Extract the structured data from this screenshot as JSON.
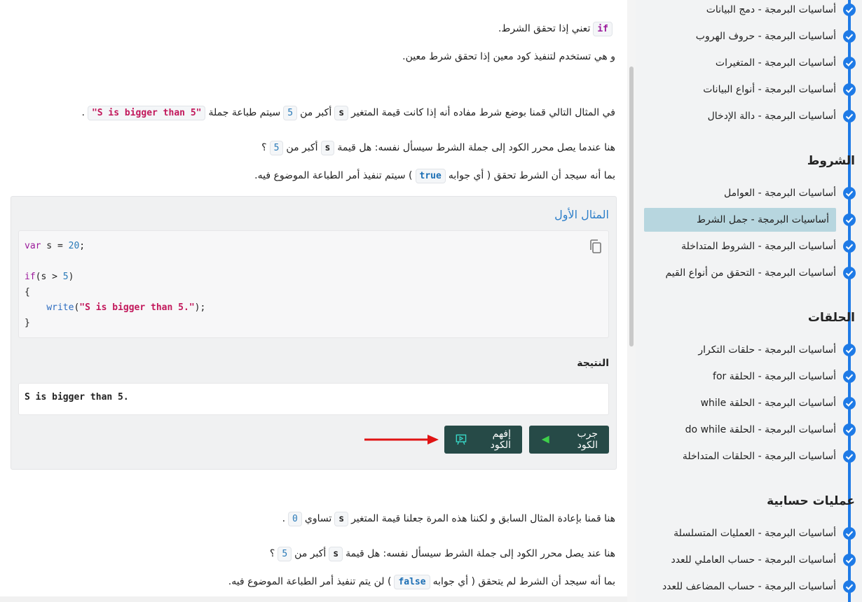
{
  "main": {
    "p1": {
      "code": "if",
      "text": "تعني إذا تحقق الشرط."
    },
    "p2": {
      "text": "و هي تستخدم لتنفيذ كود معين إذا تحقق شرط معين."
    },
    "p3": {
      "a": "في المثال التالي قمنا بوضع شرط مفاده أنه إذا كانت قيمة المتغير",
      "var": "s",
      "b": "أكبر من",
      "num": "5",
      "c": "سيتم طباعة جملة",
      "str": "\"S is bigger than 5\"",
      "d": "."
    },
    "p4": {
      "a": "هنا عندما يصل محرر الكود إلى جملة الشرط سيسأل نفسه: هل قيمة",
      "var": "s",
      "b": "أكبر من",
      "num": "5",
      "c": "؟"
    },
    "p5": {
      "a": "بما أنه سيجد أن الشرط تحقق ( أي جوابه",
      "bool": "true",
      "b": ") سيتم تنفيذ أمر الطباعة الموضوع فيه."
    },
    "example": {
      "title": "المثال الأول",
      "code": {
        "line1": {
          "kw": "var",
          "rest": " s = ",
          "num": "20",
          "end": ";"
        },
        "line3": {
          "kw": "if",
          "a": "(s > ",
          "num": "5",
          "b": ")"
        },
        "line4": "{",
        "line5": {
          "indent": "    ",
          "fn": "write",
          "a": "(",
          "str": "\"S is bigger than 5.\"",
          "b": ");"
        },
        "line6": "}"
      },
      "result_label": "النتيجة",
      "result": "S is bigger than 5.",
      "try_button": "جرب الكود",
      "explain_button": "إفهم الكود"
    },
    "p6": {
      "a": "هنا قمنا بإعادة المثال السابق و لكننا هذه المرة جعلنا قيمة المتغير",
      "var": "s",
      "b": "تساوي",
      "num": "0",
      "c": "."
    },
    "p7": {
      "a": "هنا عند يصل محرر الكود إلى جملة الشرط سيسأل نفسه: هل قيمة",
      "var": "s",
      "b": "أكبر من",
      "num": "5",
      "c": "؟"
    },
    "p8": {
      "a": "بما أنه سيجد أن الشرط لم يتحقق ( أي جوابه",
      "bool": "false",
      "b": ") لن يتم تنفيذ أمر الطباعة الموضوع فيه."
    }
  },
  "sidebar": {
    "section0_items": [
      "أساسيات البرمجة - دمج البيانات",
      "أساسيات البرمجة - حروف الهروب",
      "أساسيات البرمجة - المتغيرات",
      "أساسيات البرمجة - أنواع البيانات",
      "أساسيات البرمجة - دالة الإدخال"
    ],
    "section1_title": "الشروط",
    "section1_items": [
      "أساسيات البرمجة - العوامل",
      "أساسيات البرمجة - جمل الشرط",
      "أساسيات البرمجة - الشروط المتداخلة",
      "أساسيات البرمجة - التحقق من أنواع القيم"
    ],
    "section2_title": "الحلقات",
    "section2_items": [
      "أساسيات البرمجة - حلقات التكرار",
      "أساسيات البرمجة - الحلقة for",
      "أساسيات البرمجة - الحلقة while",
      "أساسيات البرمجة - الحلقة do while",
      "أساسيات البرمجة - الحلقات المتداخلة"
    ],
    "section3_title": "عمليات حسابية",
    "section3_items": [
      "أساسيات البرمجة - العمليات المتسلسلة",
      "أساسيات البرمجة - حساب العاملي للعدد",
      "أساسيات البرمجة - حساب المضاعف للعدد"
    ]
  },
  "colors": {
    "accent": "#1e7ae6",
    "button_bg": "#264a47",
    "active_item_bg": "#b7d6df",
    "title_blue": "#2d7fc9"
  }
}
